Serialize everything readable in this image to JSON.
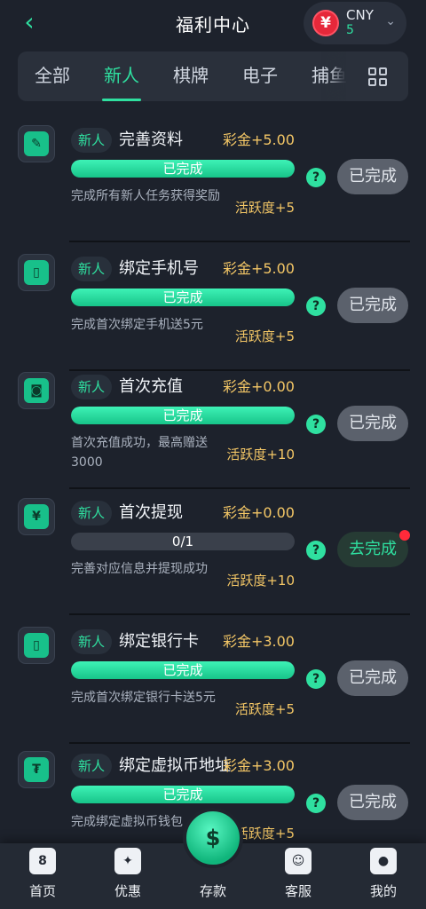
{
  "header": {
    "back_icon": "chevron-left-icon",
    "title": "福利中心"
  },
  "currency": {
    "symbol": "¥",
    "code": "CNY",
    "balance": "5",
    "icon": "chevron-down-icon"
  },
  "tabs": [
    {
      "label": "全部"
    },
    {
      "label": "新人"
    },
    {
      "label": "棋牌"
    },
    {
      "label": "电子"
    },
    {
      "label": "捕鱼"
    }
  ],
  "active_tab": "新人",
  "tasks": [
    {
      "icon": "edit-profile-icon",
      "glyph": "✎",
      "tag": "新人",
      "name": "完善资料",
      "reward": "彩金+5.00",
      "progress_label": "已完成",
      "progress": 1.0,
      "desc": "完成所有新人任务获得奖励",
      "activity": "活跃度+5",
      "action": "已完成"
    },
    {
      "icon": "phone-icon",
      "glyph": "▯",
      "tag": "新人",
      "name": "绑定手机号",
      "reward": "彩金+5.00",
      "progress_label": "已完成",
      "progress": 1.0,
      "desc": "完成首次绑定手机送5元",
      "activity": "活跃度+5",
      "action": "已完成"
    },
    {
      "icon": "wallet-icon",
      "glyph": "◙",
      "tag": "新人",
      "name": "首次充值",
      "reward": "彩金+0.00",
      "progress_label": "已完成",
      "progress": 1.0,
      "desc": "首次充值成功，最高赠送3000",
      "activity": "活跃度+10",
      "action": "已完成"
    },
    {
      "icon": "withdraw-icon",
      "glyph": "¥",
      "tag": "新人",
      "name": "首次提现",
      "reward": "彩金+0.00",
      "progress_label": "0/1",
      "progress": 0.0,
      "desc": "完善对应信息并提现成功",
      "activity": "活跃度+10",
      "action": "去完成"
    },
    {
      "icon": "bank-card-icon",
      "glyph": "▯",
      "tag": "新人",
      "name": "绑定银行卡",
      "reward": "彩金+3.00",
      "progress_label": "已完成",
      "progress": 1.0,
      "desc": "完成首次绑定银行卡送5元",
      "activity": "活跃度+5",
      "action": "已完成"
    },
    {
      "icon": "crypto-icon",
      "glyph": "₮",
      "tag": "新人",
      "name": "绑定虚拟币地址",
      "reward": "彩金+3.00",
      "progress_label": "已完成",
      "progress": 1.0,
      "desc": "完成绑定虚拟币钱包",
      "activity": "活跃度+5",
      "action": "已完成"
    }
  ],
  "bottom_nav": [
    {
      "label": "首页",
      "icon": "home-icon",
      "glyph": "8"
    },
    {
      "label": "优惠",
      "icon": "gift-icon",
      "glyph": "✦"
    },
    {
      "label": "存款",
      "icon": "deposit-icon",
      "glyph": ""
    },
    {
      "label": "客服",
      "icon": "support-icon",
      "glyph": "☺"
    },
    {
      "label": "我的",
      "icon": "profile-icon",
      "glyph": "●"
    }
  ],
  "deposit_glyph": "$",
  "colors": {
    "accent": "#2fe0a0",
    "reward": "#f4c766",
    "background": "#1d222c"
  }
}
